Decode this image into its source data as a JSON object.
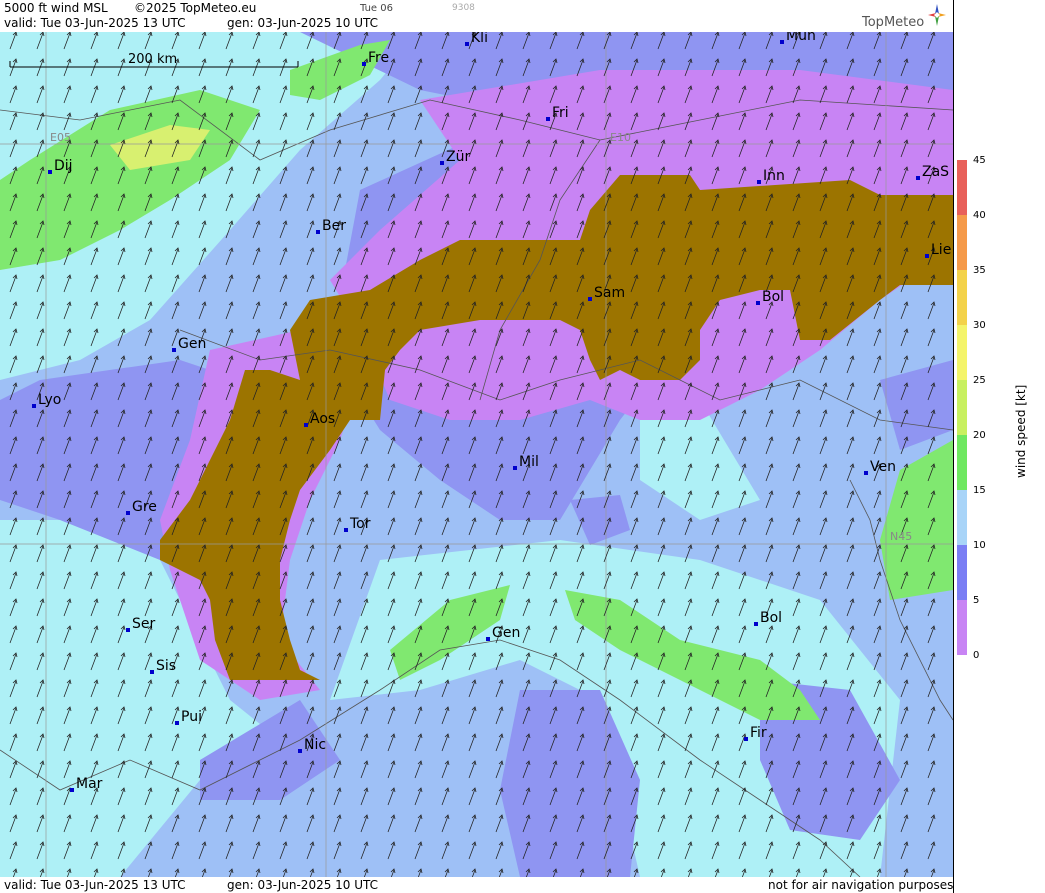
{
  "header": {
    "title": "5000 ft wind MSL",
    "copyright": "©2025 TopMeteo.eu",
    "tab_day": "Tue 06",
    "tab_code": "9308",
    "valid": "valid:  Tue  03-Jun-2025  13 UTC",
    "gen": "gen:  03-Jun-2025 10 UTC",
    "logo": "TopMeteo"
  },
  "footer": {
    "valid": "valid:  Tue  03-Jun-2025  13 UTC",
    "gen": "gen:  03-Jun-2025 10 UTC",
    "disclaimer": "not for air navigation purposes"
  },
  "map": {
    "scale_label": "200 km",
    "grid_labels": [
      "E05",
      "E10",
      "N45"
    ],
    "cities": [
      {
        "name": "Kli"
      },
      {
        "name": "Mün"
      },
      {
        "name": "Fre"
      },
      {
        "name": "Fri"
      },
      {
        "name": "Dij"
      },
      {
        "name": "Zür"
      },
      {
        "name": "Inn"
      },
      {
        "name": "ZaS"
      },
      {
        "name": "Ber"
      },
      {
        "name": "Lie"
      },
      {
        "name": "Sam"
      },
      {
        "name": "Bol"
      },
      {
        "name": "Gen"
      },
      {
        "name": "Lyo"
      },
      {
        "name": "Aos"
      },
      {
        "name": "Mil"
      },
      {
        "name": "Ven"
      },
      {
        "name": "Gre"
      },
      {
        "name": "Tor"
      },
      {
        "name": "Gen"
      },
      {
        "name": "Bol"
      },
      {
        "name": "Ser"
      },
      {
        "name": "Sis"
      },
      {
        "name": "Pui"
      },
      {
        "name": "Nic"
      },
      {
        "name": "Fir"
      },
      {
        "name": "Mar"
      }
    ]
  },
  "legend": {
    "label": "wind speed [kt]",
    "ticks": [
      "45",
      "40",
      "35",
      "30",
      "25",
      "20",
      "15",
      "10",
      "5",
      "0"
    ],
    "colors": [
      "#e8605a",
      "#f59a4a",
      "#f3d24a",
      "#f4f46a",
      "#c8f060",
      "#6ee860",
      "#a8d4f8",
      "#8fb8f8",
      "#7a7ef4",
      "#c884f4"
    ]
  },
  "colors": {
    "terrain": "#9c7400",
    "calm": "#c884f4",
    "light": "#8f95f2",
    "moderate": "#9ec0f6",
    "fresh": "#aef0f6",
    "strong": "#80e870"
  }
}
